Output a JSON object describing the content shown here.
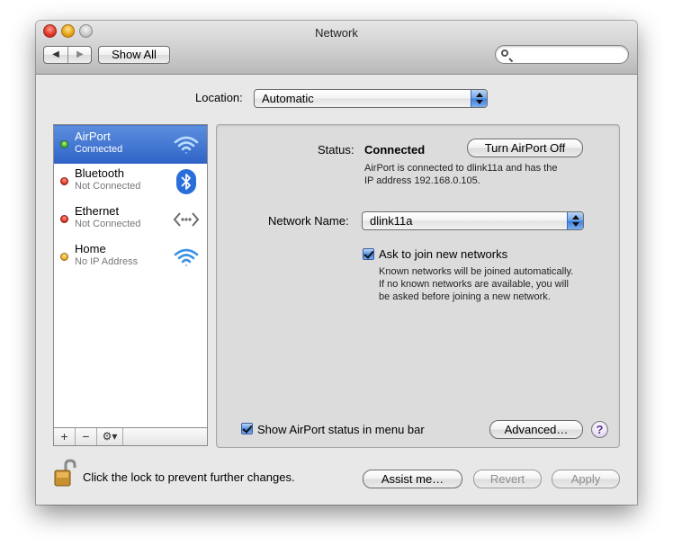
{
  "window": {
    "title": "Network"
  },
  "toolbar": {
    "show_all_label": "Show All",
    "search_placeholder": "",
    "search_value": ""
  },
  "location": {
    "label": "Location:",
    "value": "Automatic"
  },
  "services": [
    {
      "name": "AirPort",
      "status": "Connected",
      "indicator": "green",
      "icon": "wifi-icon",
      "selected": true
    },
    {
      "name": "Bluetooth",
      "status": "Not Connected",
      "indicator": "red",
      "icon": "bluetooth-icon",
      "selected": false
    },
    {
      "name": "Ethernet",
      "status": "Not Connected",
      "indicator": "red",
      "icon": "ethernet-icon",
      "selected": false
    },
    {
      "name": "Home",
      "status": "No IP Address",
      "indicator": "yellow",
      "icon": "wifi-icon",
      "selected": false
    }
  ],
  "sidebar_buttons": {
    "add": "+",
    "remove": "−",
    "gear": "⚙▾"
  },
  "detail": {
    "status_label": "Status:",
    "status_value": "Connected",
    "turn_off_button": "Turn AirPort Off",
    "status_desc_line1": "AirPort is connected to dlink11a and has the",
    "status_desc_line2": "IP address 192.168.0.105.",
    "network_name_label": "Network Name:",
    "network_name_value": "dlink11a",
    "ask_join_label": "Ask to join new networks",
    "ask_join_checked": true,
    "ask_join_desc_line1": "Known networks will be joined automatically.",
    "ask_join_desc_line2": "If no known networks are available, you will",
    "ask_join_desc_line3": "be asked before joining a new network.",
    "show_status_label": "Show AirPort status in menu bar",
    "show_status_checked": true,
    "advanced_button": "Advanced…",
    "help_label": "?"
  },
  "footer": {
    "lock_message": "Click the lock to prevent further changes.",
    "assist_button": "Assist me…",
    "revert_button": "Revert",
    "apply_button": "Apply"
  },
  "colors": {
    "selection": "#3a6fd0",
    "indicator_green": "#38b02a",
    "indicator_red": "#d8281b",
    "indicator_yellow": "#e9a417",
    "wifi_blue": "#3b92e6"
  }
}
